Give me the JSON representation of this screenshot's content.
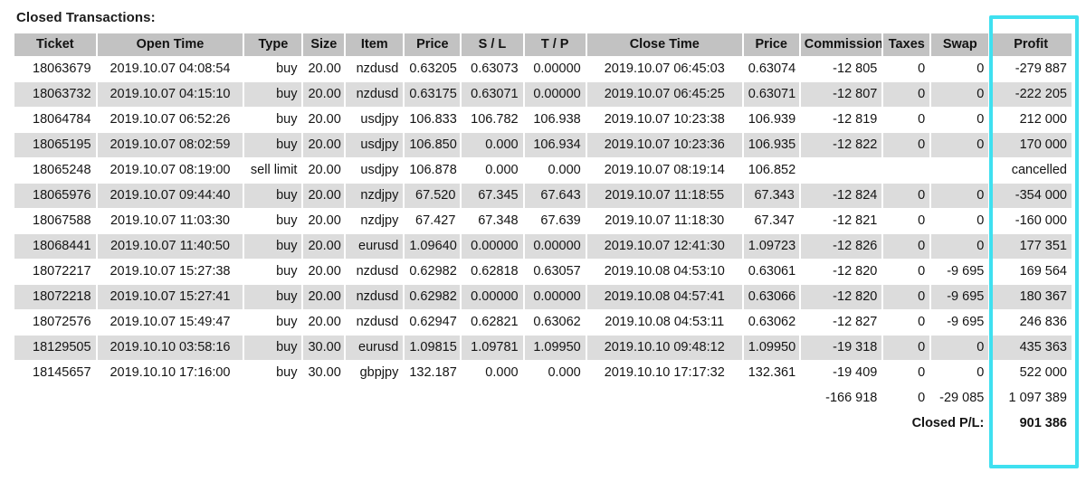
{
  "title": "Closed Transactions:",
  "accent_color": "#3fe0f0",
  "header_bg": "#c2c2c2",
  "row_alt_bg": "#dcdcdc",
  "columns": [
    "Ticket",
    "Open Time",
    "Type",
    "Size",
    "Item",
    "Price",
    "S / L",
    "T / P",
    "Close Time",
    "Price",
    "Commission",
    "Taxes",
    "Swap",
    "Profit"
  ],
  "rows": [
    {
      "ticket": "18063679",
      "open_time": "2019.10.07 04:08:54",
      "type": "buy",
      "size": "20.00",
      "item": "nzdusd",
      "price": "0.63205",
      "sl": "0.63073",
      "tp": "0.00000",
      "close_time": "2019.10.07 06:45:03",
      "close_price": "0.63074",
      "commission": "-12 805",
      "taxes": "0",
      "swap": "0",
      "profit": "-279 887"
    },
    {
      "ticket": "18063732",
      "open_time": "2019.10.07 04:15:10",
      "type": "buy",
      "size": "20.00",
      "item": "nzdusd",
      "price": "0.63175",
      "sl": "0.63071",
      "tp": "0.00000",
      "close_time": "2019.10.07 06:45:25",
      "close_price": "0.63071",
      "commission": "-12 807",
      "taxes": "0",
      "swap": "0",
      "profit": "-222 205"
    },
    {
      "ticket": "18064784",
      "open_time": "2019.10.07 06:52:26",
      "type": "buy",
      "size": "20.00",
      "item": "usdjpy",
      "price": "106.833",
      "sl": "106.782",
      "tp": "106.938",
      "close_time": "2019.10.07 10:23:38",
      "close_price": "106.939",
      "commission": "-12 819",
      "taxes": "0",
      "swap": "0",
      "profit": "212 000"
    },
    {
      "ticket": "18065195",
      "open_time": "2019.10.07 08:02:59",
      "type": "buy",
      "size": "20.00",
      "item": "usdjpy",
      "price": "106.850",
      "sl": "0.000",
      "tp": "106.934",
      "close_time": "2019.10.07 10:23:36",
      "close_price": "106.935",
      "commission": "-12 822",
      "taxes": "0",
      "swap": "0",
      "profit": "170 000"
    },
    {
      "ticket": "18065248",
      "open_time": "2019.10.07 08:19:00",
      "type": "sell limit",
      "size": "20.00",
      "item": "usdjpy",
      "price": "106.878",
      "sl": "0.000",
      "tp": "0.000",
      "close_time": "2019.10.07 08:19:14",
      "close_price": "106.852",
      "commission": "",
      "taxes": "",
      "swap": "",
      "profit": "cancelled"
    },
    {
      "ticket": "18065976",
      "open_time": "2019.10.07 09:44:40",
      "type": "buy",
      "size": "20.00",
      "item": "nzdjpy",
      "price": "67.520",
      "sl": "67.345",
      "tp": "67.643",
      "close_time": "2019.10.07 11:18:55",
      "close_price": "67.343",
      "commission": "-12 824",
      "taxes": "0",
      "swap": "0",
      "profit": "-354 000"
    },
    {
      "ticket": "18067588",
      "open_time": "2019.10.07 11:03:30",
      "type": "buy",
      "size": "20.00",
      "item": "nzdjpy",
      "price": "67.427",
      "sl": "67.348",
      "tp": "67.639",
      "close_time": "2019.10.07 11:18:30",
      "close_price": "67.347",
      "commission": "-12 821",
      "taxes": "0",
      "swap": "0",
      "profit": "-160 000"
    },
    {
      "ticket": "18068441",
      "open_time": "2019.10.07 11:40:50",
      "type": "buy",
      "size": "20.00",
      "item": "eurusd",
      "price": "1.09640",
      "sl": "0.00000",
      "tp": "0.00000",
      "close_time": "2019.10.07 12:41:30",
      "close_price": "1.09723",
      "commission": "-12 826",
      "taxes": "0",
      "swap": "0",
      "profit": "177 351"
    },
    {
      "ticket": "18072217",
      "open_time": "2019.10.07 15:27:38",
      "type": "buy",
      "size": "20.00",
      "item": "nzdusd",
      "price": "0.62982",
      "sl": "0.62818",
      "tp": "0.63057",
      "close_time": "2019.10.08 04:53:10",
      "close_price": "0.63061",
      "commission": "-12 820",
      "taxes": "0",
      "swap": "-9 695",
      "profit": "169 564"
    },
    {
      "ticket": "18072218",
      "open_time": "2019.10.07 15:27:41",
      "type": "buy",
      "size": "20.00",
      "item": "nzdusd",
      "price": "0.62982",
      "sl": "0.00000",
      "tp": "0.00000",
      "close_time": "2019.10.08 04:57:41",
      "close_price": "0.63066",
      "commission": "-12 820",
      "taxes": "0",
      "swap": "-9 695",
      "profit": "180 367"
    },
    {
      "ticket": "18072576",
      "open_time": "2019.10.07 15:49:47",
      "type": "buy",
      "size": "20.00",
      "item": "nzdusd",
      "price": "0.62947",
      "sl": "0.62821",
      "tp": "0.63062",
      "close_time": "2019.10.08 04:53:11",
      "close_price": "0.63062",
      "commission": "-12 827",
      "taxes": "0",
      "swap": "-9 695",
      "profit": "246 836"
    },
    {
      "ticket": "18129505",
      "open_time": "2019.10.10 03:58:16",
      "type": "buy",
      "size": "30.00",
      "item": "eurusd",
      "price": "1.09815",
      "sl": "1.09781",
      "tp": "1.09950",
      "close_time": "2019.10.10 09:48:12",
      "close_price": "1.09950",
      "commission": "-19 318",
      "taxes": "0",
      "swap": "0",
      "profit": "435 363"
    },
    {
      "ticket": "18145657",
      "open_time": "2019.10.10 17:16:00",
      "type": "buy",
      "size": "30.00",
      "item": "gbpjpy",
      "price": "132.187",
      "sl": "0.000",
      "tp": "0.000",
      "close_time": "2019.10.10 17:17:32",
      "close_price": "132.361",
      "commission": "-19 409",
      "taxes": "0",
      "swap": "0",
      "profit": "522 000"
    }
  ],
  "subtotal": {
    "commission": "-166 918",
    "taxes": "0",
    "swap": "-29 085",
    "profit": "1 097 389"
  },
  "closed_pl": {
    "label": "Closed P/L:",
    "value": "901 386"
  },
  "chart_data": {
    "type": "table",
    "title": "Closed Transactions:",
    "columns": [
      "Ticket",
      "Open Time",
      "Type",
      "Size",
      "Item",
      "Price",
      "S / L",
      "T / P",
      "Close Time",
      "Price",
      "Commission",
      "Taxes",
      "Swap",
      "Profit"
    ],
    "highlighted_column": "Profit",
    "profit_values": [
      -279887,
      -222205,
      212000,
      170000,
      null,
      -354000,
      -160000,
      177351,
      169564,
      180367,
      246836,
      435363,
      522000
    ],
    "commission_values": [
      -12805,
      -12807,
      -12819,
      -12822,
      null,
      -12824,
      -12821,
      -12826,
      -12820,
      -12820,
      -12827,
      -19318,
      -19409
    ],
    "swap_values": [
      0,
      0,
      0,
      0,
      null,
      0,
      0,
      0,
      -9695,
      -9695,
      -9695,
      0,
      0
    ],
    "taxes_values": [
      0,
      0,
      0,
      0,
      null,
      0,
      0,
      0,
      0,
      0,
      0,
      0,
      0
    ],
    "totals": {
      "commission": -166918,
      "taxes": 0,
      "swap": -29085,
      "gross_profit": 1097389,
      "closed_pl": 901386
    },
    "row_count": 13
  }
}
